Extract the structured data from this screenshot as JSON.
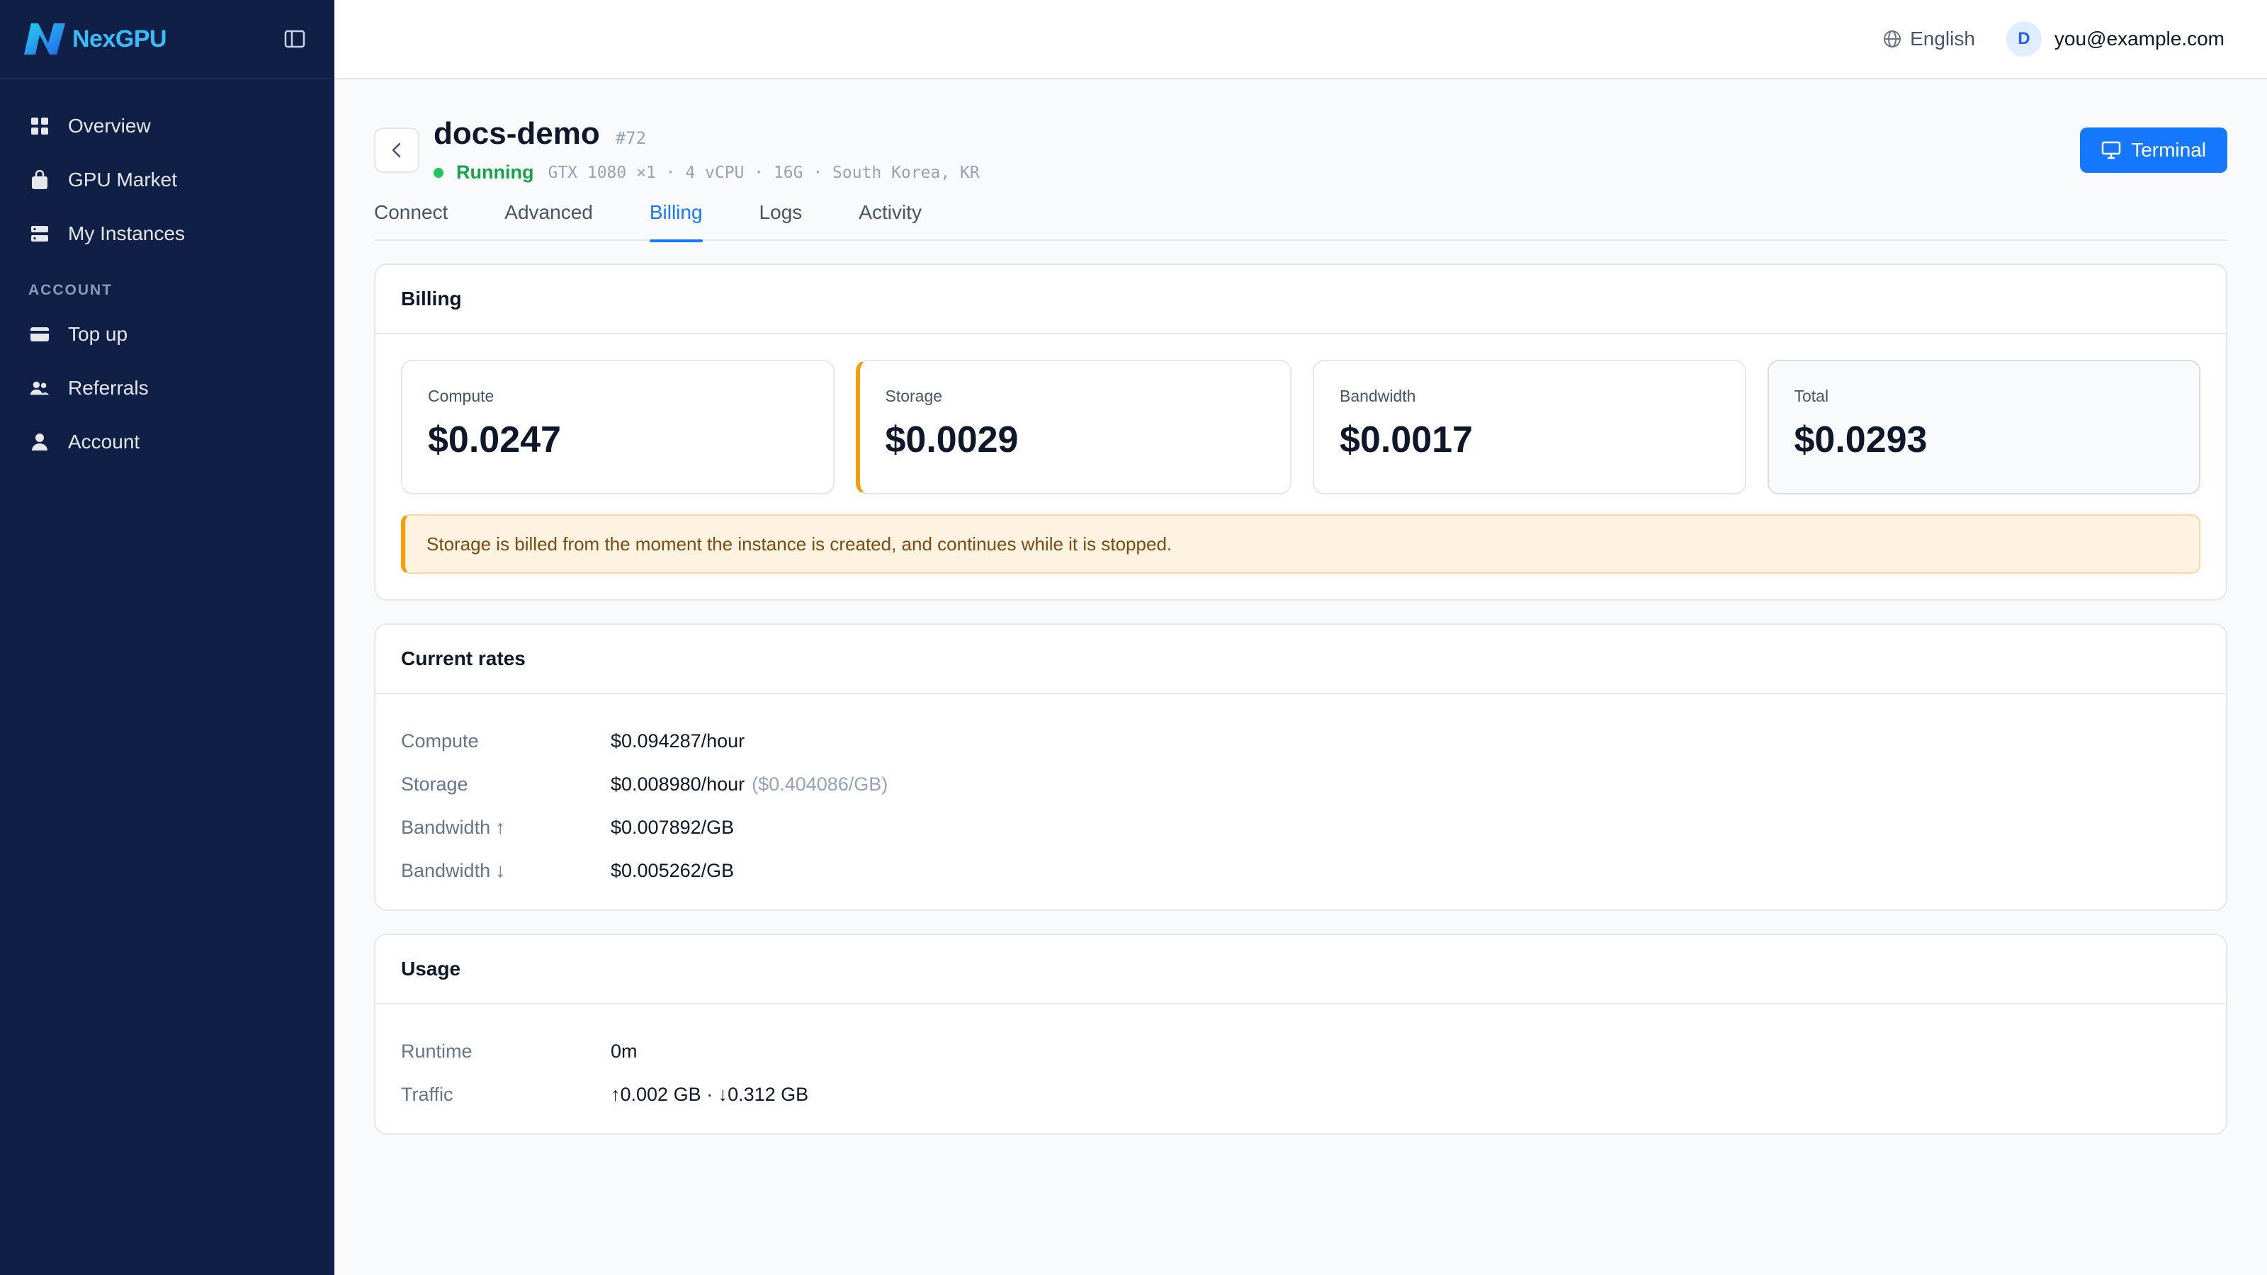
{
  "sidebar": {
    "logo": "NexGPU",
    "nav": [
      {
        "label": "Overview",
        "icon": "grid-icon"
      },
      {
        "label": "GPU Market",
        "icon": "shopping-bag-icon"
      },
      {
        "label": "My Instances",
        "icon": "server-icon"
      }
    ],
    "account_section": "ACCOUNT",
    "account_nav": [
      {
        "label": "Top up",
        "icon": "credit-card-icon"
      },
      {
        "label": "Referrals",
        "icon": "users-icon"
      },
      {
        "label": "Account",
        "icon": "user-icon"
      }
    ]
  },
  "topbar": {
    "language": "English",
    "avatar_initial": "D",
    "email": "you@example.com"
  },
  "instance": {
    "name": "docs-demo",
    "id": "#72",
    "status": "Running",
    "specs": "GTX 1080 ×1 · 4 vCPU · 16G · South Korea, KR",
    "terminal_label": "Terminal"
  },
  "tabs": [
    "Connect",
    "Advanced",
    "Billing",
    "Logs",
    "Activity"
  ],
  "active_tab": "Billing",
  "billing": {
    "title": "Billing",
    "stats": [
      {
        "label": "Compute",
        "value": "$0.0247"
      },
      {
        "label": "Storage",
        "value": "$0.0029"
      },
      {
        "label": "Bandwidth",
        "value": "$0.0017"
      },
      {
        "label": "Total",
        "value": "$0.0293"
      }
    ],
    "notice": "Storage is billed from the moment the instance is created, and continues while it is stopped."
  },
  "rates": {
    "title": "Current rates",
    "rows": [
      {
        "label": "Compute",
        "value": "$0.094287/hour",
        "extra": ""
      },
      {
        "label": "Storage",
        "value": "$0.008980/hour",
        "extra": "($0.404086/GB)"
      },
      {
        "label": "Bandwidth ↑",
        "value": "$0.007892/GB",
        "extra": ""
      },
      {
        "label": "Bandwidth ↓",
        "value": "$0.005262/GB",
        "extra": ""
      }
    ]
  },
  "usage": {
    "title": "Usage",
    "rows": [
      {
        "label": "Runtime",
        "value": "0m"
      },
      {
        "label": "Traffic",
        "value": "↑0.002 GB · ↓0.312 GB"
      }
    ]
  },
  "colors": {
    "accent": "#1677ff",
    "sidebar_bg": "#0f1f45",
    "running": "#16a34a",
    "warning": "#f59e0b"
  }
}
